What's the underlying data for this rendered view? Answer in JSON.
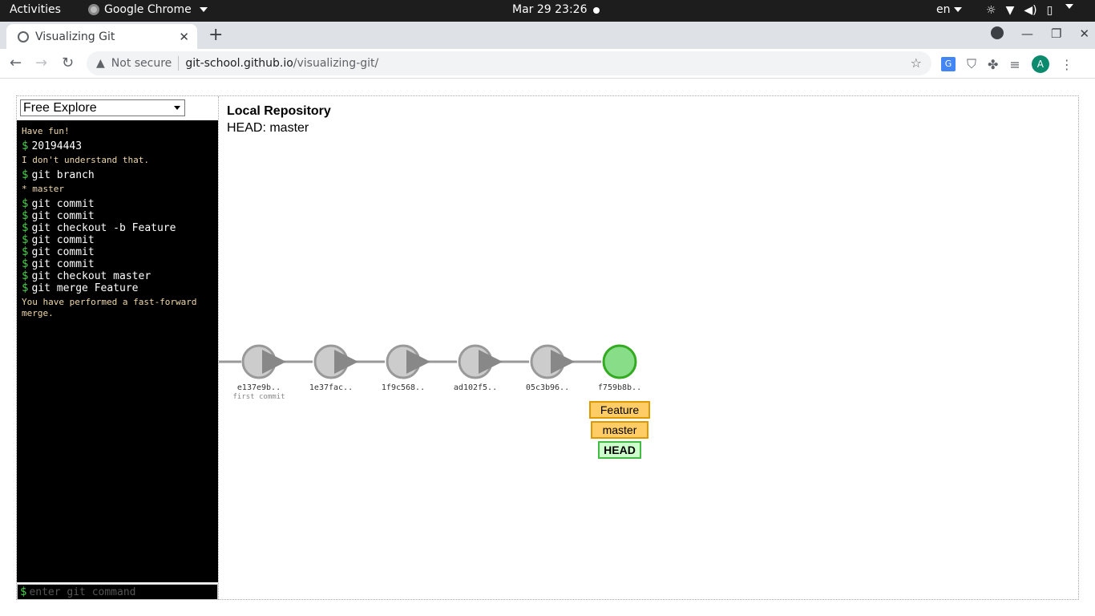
{
  "os": {
    "activities": "Activities",
    "app_name": "Google Chrome",
    "clock": "Mar 29  23:26",
    "lang": "en"
  },
  "browser": {
    "tab_title": "Visualizing Git",
    "not_secure": "Not secure",
    "url_host": "git-school.github.io",
    "url_path": "/visualizing-git/",
    "avatar_letter": "A"
  },
  "scenario": {
    "selected": "Free Explore"
  },
  "console": {
    "lines": [
      {
        "type": "info",
        "text": "Have fun!"
      },
      {
        "type": "cmd",
        "text": "20194443"
      },
      {
        "type": "info",
        "text": "I don't understand that."
      },
      {
        "type": "cmd",
        "text": "git branch"
      },
      {
        "type": "info",
        "text": "* master"
      },
      {
        "type": "cmd",
        "text": "git commit"
      },
      {
        "type": "cmd",
        "text": "git commit"
      },
      {
        "type": "cmd",
        "text": "git checkout -b Feature"
      },
      {
        "type": "cmd",
        "text": "git commit"
      },
      {
        "type": "cmd",
        "text": "git commit"
      },
      {
        "type": "cmd",
        "text": "git commit"
      },
      {
        "type": "cmd",
        "text": "git checkout master"
      },
      {
        "type": "cmd",
        "text": "git merge Feature"
      },
      {
        "type": "info",
        "text": "You have performed a fast-forward merge."
      }
    ],
    "input_placeholder": "enter git command"
  },
  "repo": {
    "title": "Local Repository",
    "head_label": "HEAD: master",
    "commits": [
      {
        "id": "e137e9b..",
        "message": "first commit",
        "current": false
      },
      {
        "id": "1e37fac..",
        "message": "",
        "current": false
      },
      {
        "id": "1f9c568..",
        "message": "",
        "current": false
      },
      {
        "id": "ad102f5..",
        "message": "",
        "current": false
      },
      {
        "id": "05c3b96..",
        "message": "",
        "current": false
      },
      {
        "id": "f759b8b..",
        "message": "",
        "current": true
      }
    ],
    "refs": [
      {
        "label": "Feature",
        "kind": "branch"
      },
      {
        "label": "master",
        "kind": "branch"
      },
      {
        "label": "HEAD",
        "kind": "head"
      }
    ]
  },
  "colors": {
    "commit_fill": "#cccccc",
    "commit_stroke": "#999999",
    "current_fill": "#88dd88",
    "current_stroke": "#33aa22",
    "branch_fill": "#ffcc66",
    "branch_stroke": "#dd9900",
    "head_fill": "#ccffcc",
    "head_stroke": "#44bb44"
  }
}
